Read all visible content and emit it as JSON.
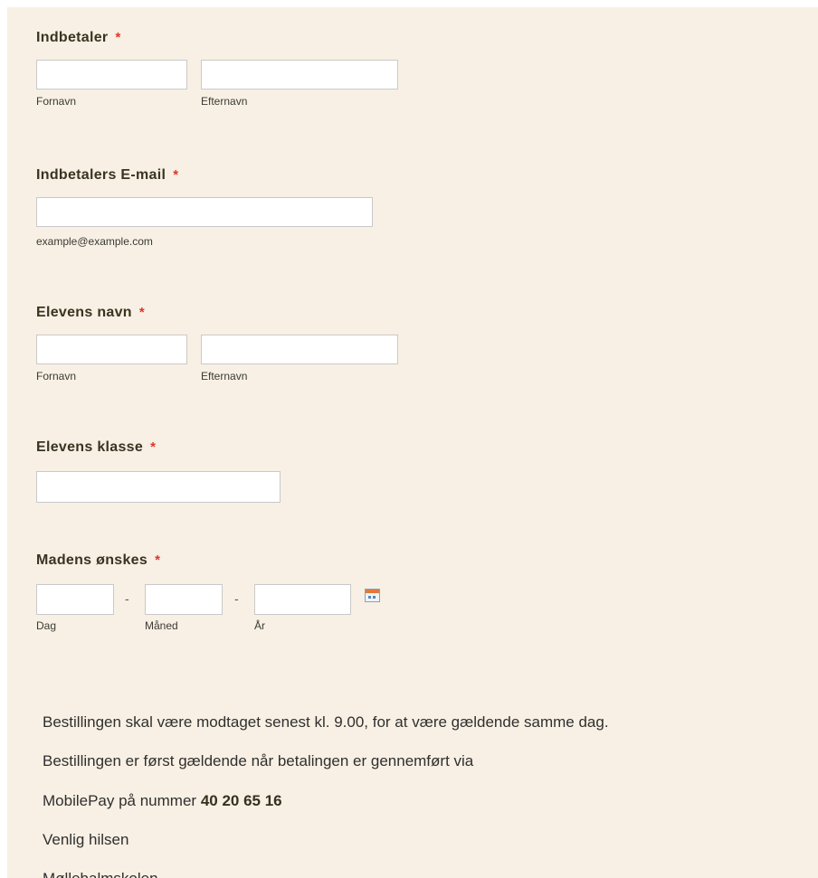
{
  "payer": {
    "label": "Indbetaler",
    "required_mark": "*",
    "first_name_sublabel": "Fornavn",
    "last_name_sublabel": "Efternavn",
    "first_name_value": "",
    "last_name_value": ""
  },
  "payer_email": {
    "label": "Indbetalers E-mail",
    "required_mark": "*",
    "sublabel": "example@example.com",
    "value": ""
  },
  "student_name": {
    "label": "Elevens navn",
    "required_mark": "*",
    "first_name_sublabel": "Fornavn",
    "last_name_sublabel": "Efternavn",
    "first_name_value": "",
    "last_name_value": ""
  },
  "student_class": {
    "label": "Elevens klasse",
    "required_mark": "*",
    "value": ""
  },
  "food_date": {
    "label": "Madens ønskes",
    "required_mark": "*",
    "separator": "-",
    "day_sublabel": "Dag",
    "month_sublabel": "Måned",
    "year_sublabel": "År",
    "day_value": "",
    "month_value": "",
    "year_value": "",
    "calendar_icon": "calendar-icon"
  },
  "info": {
    "line1": "Bestillingen skal være modtaget senest kl. 9.00, for at være gældende samme dag.",
    "line2": "Bestillingen er først gældende når betalingen er gennemført via",
    "line3_prefix": "MobilePay på nummer ",
    "mobilepay_number": "40 20 65 16",
    "line4": "Venlig hilsen",
    "line5": "Møllebalmskolen"
  },
  "colors": {
    "panel_background": "#f8f0e4",
    "label_text": "#383421",
    "required": "#e0352b"
  }
}
